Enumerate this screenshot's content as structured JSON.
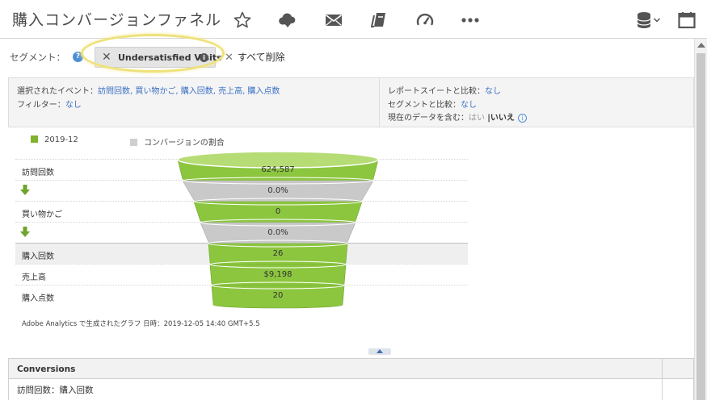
{
  "header": {
    "title": "購入コンバージョンファネル",
    "icons": [
      "star-icon",
      "cloud-download-icon",
      "mail-icon",
      "bookmark-stack-icon",
      "speedometer-icon",
      "more-icon",
      "database-icon",
      "chevron-down-icon",
      "calendar-icon"
    ]
  },
  "segments": {
    "label": "セグメント：",
    "help": "?",
    "chip_label": "Undersatisfied Visits",
    "chip_info": "i",
    "clear_all": "すべて削除"
  },
  "info": {
    "events_label": "選択されたイベント：",
    "events_value": "訪問回数, 買い物かご, 購入回数, 売上高, 購入点数",
    "filter_label": "フィルター：",
    "filter_value": "なし",
    "suite_compare_label": "レポートスイートと比較：",
    "suite_compare_value": "なし",
    "segment_compare_label": "セグメントと比較：",
    "segment_compare_value": "なし",
    "current_data_label": "現在のデータを含む：",
    "current_yes": "はい",
    "current_sep": "|",
    "current_no": "いいえ",
    "current_info": "i"
  },
  "chart": {
    "legend": [
      {
        "label": "2019-12",
        "color": "#7fb32d"
      },
      {
        "label": "コンバージョンの割合",
        "color": "#cfcfcf"
      }
    ],
    "rows": [
      {
        "label": "訪問回数",
        "value": "624,587",
        "kind": "event"
      },
      {
        "label": "",
        "value": "0.0%",
        "kind": "conversion"
      },
      {
        "label": "買い物かご",
        "value": "0",
        "kind": "event"
      },
      {
        "label": "",
        "value": "0.0%",
        "kind": "conversion"
      },
      {
        "label": "購入回数",
        "value": "26",
        "kind": "event"
      },
      {
        "label": "売上高",
        "value": "$9,198",
        "kind": "event"
      },
      {
        "label": "購入点数",
        "value": "20",
        "kind": "event"
      }
    ],
    "footnote": "Adobe Analytics で生成されたグラフ 日時：2019-12-05 14:40 GMT+5.5",
    "colors": {
      "green": "#8cc63f",
      "green_dark": "#6ea32c",
      "gray": "#c9c9c9",
      "gray_dark": "#a8a8a8"
    }
  },
  "table": {
    "header": "Conversions",
    "rows": [
      "訪問回数：購入回数"
    ]
  }
}
